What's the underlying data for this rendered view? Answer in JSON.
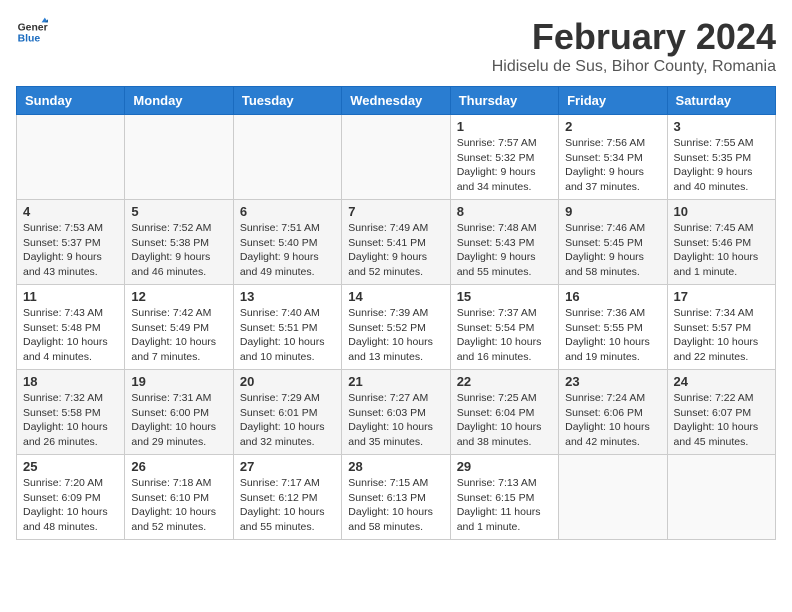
{
  "header": {
    "logo_line1": "General",
    "logo_line2": "Blue",
    "month_year": "February 2024",
    "location": "Hidiselu de Sus, Bihor County, Romania"
  },
  "weekdays": [
    "Sunday",
    "Monday",
    "Tuesday",
    "Wednesday",
    "Thursday",
    "Friday",
    "Saturday"
  ],
  "weeks": [
    [
      {
        "day": "",
        "info": ""
      },
      {
        "day": "",
        "info": ""
      },
      {
        "day": "",
        "info": ""
      },
      {
        "day": "",
        "info": ""
      },
      {
        "day": "1",
        "info": "Sunrise: 7:57 AM\nSunset: 5:32 PM\nDaylight: 9 hours\nand 34 minutes."
      },
      {
        "day": "2",
        "info": "Sunrise: 7:56 AM\nSunset: 5:34 PM\nDaylight: 9 hours\nand 37 minutes."
      },
      {
        "day": "3",
        "info": "Sunrise: 7:55 AM\nSunset: 5:35 PM\nDaylight: 9 hours\nand 40 minutes."
      }
    ],
    [
      {
        "day": "4",
        "info": "Sunrise: 7:53 AM\nSunset: 5:37 PM\nDaylight: 9 hours\nand 43 minutes."
      },
      {
        "day": "5",
        "info": "Sunrise: 7:52 AM\nSunset: 5:38 PM\nDaylight: 9 hours\nand 46 minutes."
      },
      {
        "day": "6",
        "info": "Sunrise: 7:51 AM\nSunset: 5:40 PM\nDaylight: 9 hours\nand 49 minutes."
      },
      {
        "day": "7",
        "info": "Sunrise: 7:49 AM\nSunset: 5:41 PM\nDaylight: 9 hours\nand 52 minutes."
      },
      {
        "day": "8",
        "info": "Sunrise: 7:48 AM\nSunset: 5:43 PM\nDaylight: 9 hours\nand 55 minutes."
      },
      {
        "day": "9",
        "info": "Sunrise: 7:46 AM\nSunset: 5:45 PM\nDaylight: 9 hours\nand 58 minutes."
      },
      {
        "day": "10",
        "info": "Sunrise: 7:45 AM\nSunset: 5:46 PM\nDaylight: 10 hours\nand 1 minute."
      }
    ],
    [
      {
        "day": "11",
        "info": "Sunrise: 7:43 AM\nSunset: 5:48 PM\nDaylight: 10 hours\nand 4 minutes."
      },
      {
        "day": "12",
        "info": "Sunrise: 7:42 AM\nSunset: 5:49 PM\nDaylight: 10 hours\nand 7 minutes."
      },
      {
        "day": "13",
        "info": "Sunrise: 7:40 AM\nSunset: 5:51 PM\nDaylight: 10 hours\nand 10 minutes."
      },
      {
        "day": "14",
        "info": "Sunrise: 7:39 AM\nSunset: 5:52 PM\nDaylight: 10 hours\nand 13 minutes."
      },
      {
        "day": "15",
        "info": "Sunrise: 7:37 AM\nSunset: 5:54 PM\nDaylight: 10 hours\nand 16 minutes."
      },
      {
        "day": "16",
        "info": "Sunrise: 7:36 AM\nSunset: 5:55 PM\nDaylight: 10 hours\nand 19 minutes."
      },
      {
        "day": "17",
        "info": "Sunrise: 7:34 AM\nSunset: 5:57 PM\nDaylight: 10 hours\nand 22 minutes."
      }
    ],
    [
      {
        "day": "18",
        "info": "Sunrise: 7:32 AM\nSunset: 5:58 PM\nDaylight: 10 hours\nand 26 minutes."
      },
      {
        "day": "19",
        "info": "Sunrise: 7:31 AM\nSunset: 6:00 PM\nDaylight: 10 hours\nand 29 minutes."
      },
      {
        "day": "20",
        "info": "Sunrise: 7:29 AM\nSunset: 6:01 PM\nDaylight: 10 hours\nand 32 minutes."
      },
      {
        "day": "21",
        "info": "Sunrise: 7:27 AM\nSunset: 6:03 PM\nDaylight: 10 hours\nand 35 minutes."
      },
      {
        "day": "22",
        "info": "Sunrise: 7:25 AM\nSunset: 6:04 PM\nDaylight: 10 hours\nand 38 minutes."
      },
      {
        "day": "23",
        "info": "Sunrise: 7:24 AM\nSunset: 6:06 PM\nDaylight: 10 hours\nand 42 minutes."
      },
      {
        "day": "24",
        "info": "Sunrise: 7:22 AM\nSunset: 6:07 PM\nDaylight: 10 hours\nand 45 minutes."
      }
    ],
    [
      {
        "day": "25",
        "info": "Sunrise: 7:20 AM\nSunset: 6:09 PM\nDaylight: 10 hours\nand 48 minutes."
      },
      {
        "day": "26",
        "info": "Sunrise: 7:18 AM\nSunset: 6:10 PM\nDaylight: 10 hours\nand 52 minutes."
      },
      {
        "day": "27",
        "info": "Sunrise: 7:17 AM\nSunset: 6:12 PM\nDaylight: 10 hours\nand 55 minutes."
      },
      {
        "day": "28",
        "info": "Sunrise: 7:15 AM\nSunset: 6:13 PM\nDaylight: 10 hours\nand 58 minutes."
      },
      {
        "day": "29",
        "info": "Sunrise: 7:13 AM\nSunset: 6:15 PM\nDaylight: 11 hours\nand 1 minute."
      },
      {
        "day": "",
        "info": ""
      },
      {
        "day": "",
        "info": ""
      }
    ]
  ]
}
